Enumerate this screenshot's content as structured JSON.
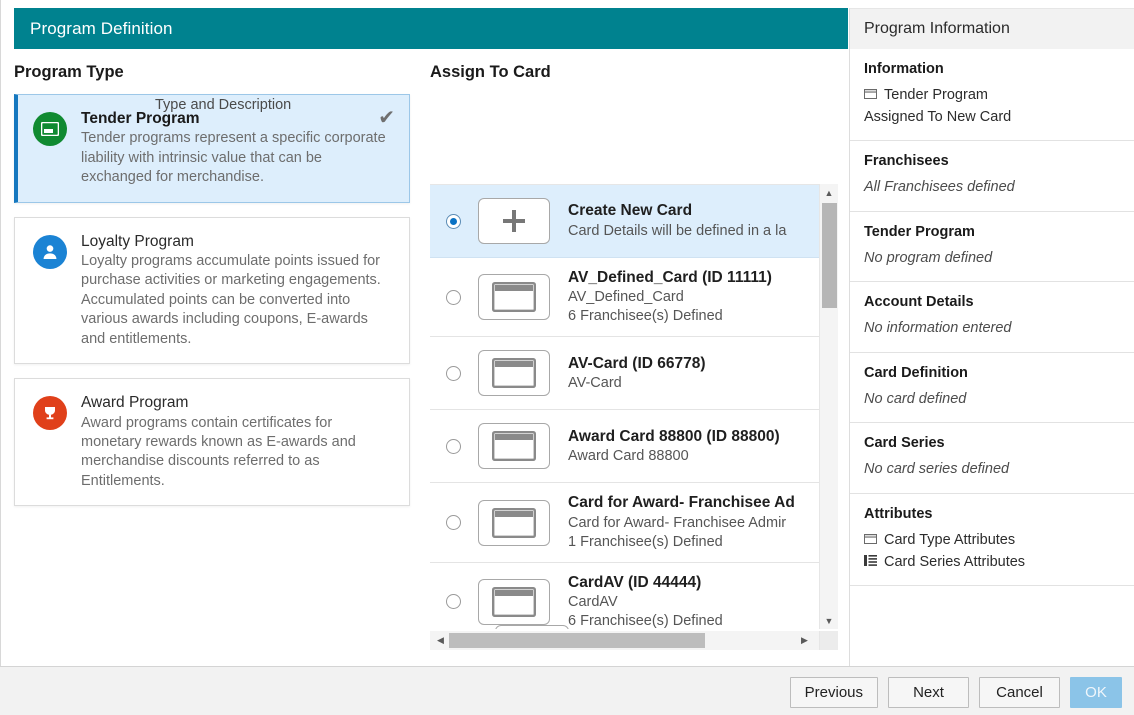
{
  "header": {
    "title": "Program Definition"
  },
  "info_panel_header": {
    "title": "Program Information"
  },
  "program_type": {
    "section_title": "Program Type",
    "items": [
      {
        "name": "Tender Program",
        "description": "Tender programs represent a specific corporate liability with intrinsic value that can be exchanged for merchandise.",
        "icon": "credit-card-icon",
        "icon_color": "#108a31",
        "selected": true,
        "check_glyph": "✔"
      },
      {
        "name": "Loyalty Program",
        "description": "Loyalty programs accumulate points issued for purchase activities or marketing engagements. Accumulated points can be converted into various awards including coupons, E-awards and entitlements.",
        "icon": "person-icon",
        "icon_color": "#1b83d4",
        "selected": false
      },
      {
        "name": "Award Program",
        "description": "Award programs contain certificates for monetary rewards known as E-awards and merchandise discounts referred to as Entitlements.",
        "icon": "trophy-icon",
        "icon_color": "#e0401a",
        "selected": false
      }
    ]
  },
  "assign_to_card": {
    "section_title": "Assign To Card",
    "column_label": "Type and Description",
    "rows": [
      {
        "title": "Create New Card",
        "sub1": "Card Details will be defined in a la",
        "sub2": "",
        "icon": "plus-icon",
        "selected": true
      },
      {
        "title": "AV_Defined_Card (ID 11111)",
        "sub1": "AV_Defined_Card",
        "sub2": "6 Franchisee(s) Defined",
        "icon": "card-icon",
        "selected": false
      },
      {
        "title": "AV-Card (ID 66778)",
        "sub1": "AV-Card",
        "sub2": "",
        "icon": "card-icon",
        "selected": false
      },
      {
        "title": "Award Card 88800 (ID 88800)",
        "sub1": "Award Card 88800",
        "sub2": "",
        "icon": "card-icon",
        "selected": false
      },
      {
        "title": "Card for Award- Franchisee Ad",
        "sub1": "Card for Award- Franchisee Admir",
        "sub2": "1 Franchisee(s) Defined",
        "icon": "card-icon",
        "selected": false
      },
      {
        "title": "CardAV (ID 44444)",
        "sub1": "CardAV",
        "sub2": "6 Franchisee(s) Defined",
        "icon": "card-icon",
        "selected": false
      }
    ],
    "next_button": "Next",
    "next_chevron": "❯"
  },
  "program_information": {
    "blocks": [
      {
        "heading": "Information",
        "lines": [
          {
            "icon": "card-outline-icon",
            "text": "Tender Program"
          },
          {
            "icon": "",
            "text": "Assigned To New Card"
          }
        ],
        "italic": false
      },
      {
        "heading": "Franchisees",
        "lines": [
          {
            "icon": "",
            "text": "All Franchisees defined"
          }
        ],
        "italic": true
      },
      {
        "heading": "Tender Program",
        "lines": [
          {
            "icon": "",
            "text": "No program defined"
          }
        ],
        "italic": true
      },
      {
        "heading": "Account Details",
        "lines": [
          {
            "icon": "",
            "text": "No information entered"
          }
        ],
        "italic": true
      },
      {
        "heading": "Card Definition",
        "lines": [
          {
            "icon": "",
            "text": "No card defined"
          }
        ],
        "italic": true
      },
      {
        "heading": "Card Series",
        "lines": [
          {
            "icon": "",
            "text": "No card series defined"
          }
        ],
        "italic": true
      },
      {
        "heading": "Attributes",
        "lines": [
          {
            "icon": "card-outline-icon",
            "text": "Card Type Attributes"
          },
          {
            "icon": "grid-list-icon",
            "text": "Card Series Attributes"
          }
        ],
        "italic": false
      }
    ]
  },
  "footer": {
    "buttons": [
      {
        "label": "Previous",
        "disabled": false
      },
      {
        "label": "Next",
        "disabled": false
      },
      {
        "label": "Cancel",
        "disabled": false
      },
      {
        "label": "OK",
        "disabled": true
      }
    ]
  },
  "colors": {
    "header_teal": "#00828f",
    "accent_blue": "#0a72c4",
    "selected_bg": "#ddeefc",
    "green": "#108a31",
    "orange": "#e0401a"
  }
}
